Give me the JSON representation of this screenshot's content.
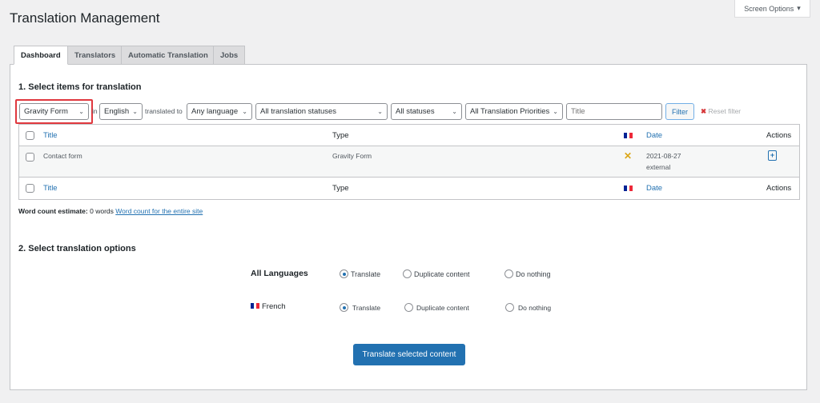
{
  "page": {
    "title": "Translation Management",
    "screen_options": "Screen Options"
  },
  "tabs": [
    {
      "label": "Dashboard"
    },
    {
      "label": "Translators"
    },
    {
      "label": "Automatic Translation"
    },
    {
      "label": "Jobs"
    }
  ],
  "section1": {
    "heading": "1. Select items for translation"
  },
  "filters": {
    "type": "Gravity Form",
    "in_label": "in",
    "source_language": "English",
    "translated_to_label": "translated to",
    "target_language": "Any language",
    "translation_status": "All translation statuses",
    "status": "All statuses",
    "priority": "All Translation Priorities",
    "title_placeholder": "Title",
    "filter_button": "Filter",
    "reset_filter": "Reset filter"
  },
  "table": {
    "columns": {
      "title": "Title",
      "type": "Type",
      "date": "Date",
      "actions": "Actions"
    },
    "rows": [
      {
        "title": "Contact form",
        "type": "Gravity Form",
        "status_icon": "x-icon",
        "date": "2021-08-27",
        "source": "external"
      }
    ]
  },
  "word_count": {
    "label": "Word count estimate:",
    "value": "0 words",
    "link": "Word count for the entire site"
  },
  "section2": {
    "heading": "2. Select translation options",
    "rows": [
      {
        "label": "All Languages",
        "options": [
          "Translate",
          "Duplicate content",
          "Do nothing"
        ],
        "selected": "Translate"
      },
      {
        "label": "French",
        "options": [
          "Translate",
          "Duplicate content",
          "Do nothing"
        ],
        "selected": "Translate"
      }
    ]
  },
  "submit": "Translate selected content",
  "colors": {
    "accent": "#2271b1",
    "highlight": "#e0383e",
    "warning": "#dba617"
  }
}
